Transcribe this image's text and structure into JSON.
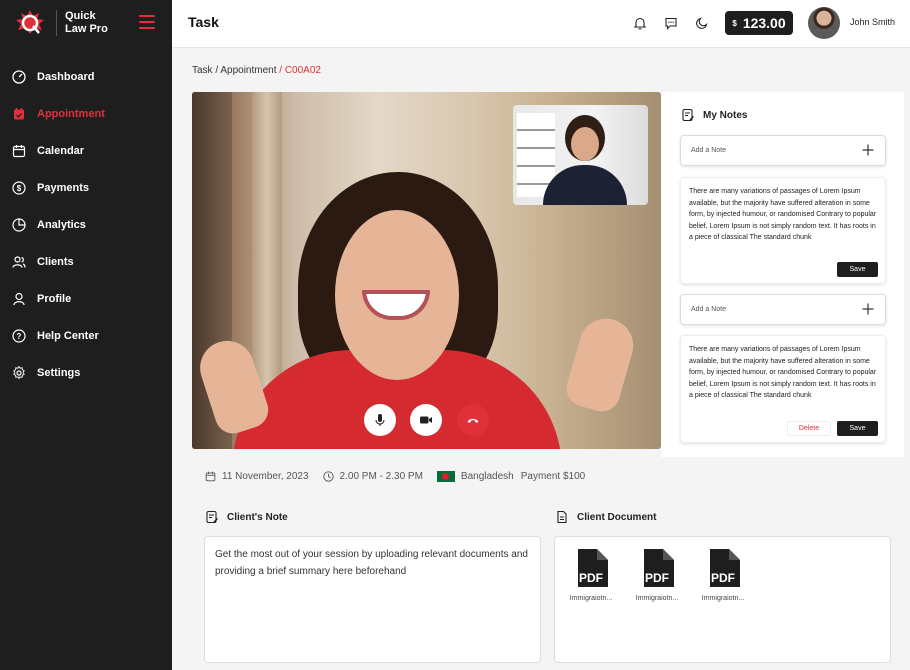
{
  "app": {
    "name_line1": "Quick",
    "name_line2": "Law Pro"
  },
  "sidebar": {
    "items": [
      {
        "label": "Dashboard",
        "icon": "dashboard-icon"
      },
      {
        "label": "Appointment",
        "icon": "calendar-check-icon",
        "active": true
      },
      {
        "label": "Calendar",
        "icon": "calendar-icon"
      },
      {
        "label": "Payments",
        "icon": "dollar-icon"
      },
      {
        "label": "Analytics",
        "icon": "pie-chart-icon"
      },
      {
        "label": "Clients",
        "icon": "users-icon"
      },
      {
        "label": "Profile",
        "icon": "user-icon"
      },
      {
        "label": "Help Center",
        "icon": "help-icon"
      },
      {
        "label": "Settings",
        "icon": "gear-icon"
      }
    ]
  },
  "header": {
    "title": "Task",
    "balance_currency": "$",
    "balance": "123.00",
    "user_name": "John Smith"
  },
  "breadcrumb": {
    "part1": "Task / Appointment",
    "current": "/ C00A02"
  },
  "notes": {
    "title": "My Notes",
    "add_placeholder_1": "Add a Note",
    "add_placeholder_2": "Add a Note",
    "note_1": "There are many variations of passages of Lorem Ipsum available, but the majority have suffered alteration in some form, by injected humour, or randomised Contrary to popular belief, Lorem Ipsum is not simply random text. It has roots in a piece of classical The standard chunk",
    "note_2": "There are many variations of passages of Lorem Ipsum available, but the majority have suffered alteration in some form, by injected humour, or randomised Contrary to popular belief, Lorem Ipsum is not simply random text. It has roots in a piece of classical The standard chunk",
    "save_label": "Save",
    "delete_label": "Delete"
  },
  "appointment": {
    "date": "11 November, 2023",
    "time": "2.00 PM - 2.30 PM",
    "country": "Bangladesh",
    "payment": "Payment $100"
  },
  "client_note": {
    "title": "Client's Note",
    "text": "Get the most out of your session by uploading relevant documents and providing a brief summary here beforehand"
  },
  "client_document": {
    "title": "Client Document",
    "files": [
      {
        "type": "PDF",
        "name": "Immigraiotn..."
      },
      {
        "type": "PDF",
        "name": "Immigraiotn..."
      },
      {
        "type": "PDF",
        "name": "Immigraiotn..."
      }
    ]
  },
  "colors": {
    "accent": "#e0303a",
    "sidebar_bg": "#1e1e1e"
  }
}
